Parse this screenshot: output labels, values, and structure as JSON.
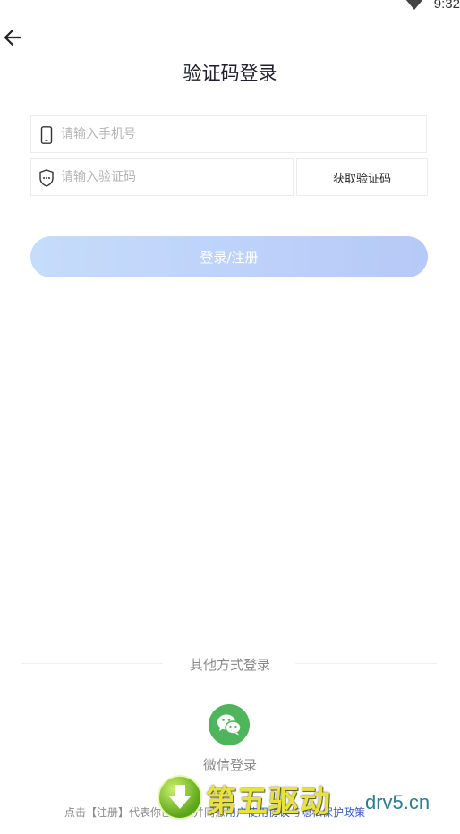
{
  "status_bar": {
    "time": "9:32"
  },
  "header": {
    "title": "验证码登录"
  },
  "form": {
    "phone_placeholder": "请输入手机号",
    "phone_value": "",
    "code_placeholder": "请输入验证码",
    "code_value": "",
    "get_code_label": "获取验证码",
    "submit_label": "登录/注册"
  },
  "other_login": {
    "label": "其他方式登录",
    "wechat_label": "微信登录"
  },
  "agreement": {
    "prefix": "点击【注册】代表你已阅读并同意",
    "user_agreement": "用户使用协议",
    "and": "与",
    "privacy_policy": "隐私保护政策"
  },
  "watermark": {
    "brand": "第五驱动",
    "domain": "drv5.cn"
  },
  "colors": {
    "button_gradient_start": "#c6dcfb",
    "button_gradient_end": "#b6c9f8",
    "wechat_green": "#4fb55d",
    "link_blue": "#3a5bbf"
  }
}
